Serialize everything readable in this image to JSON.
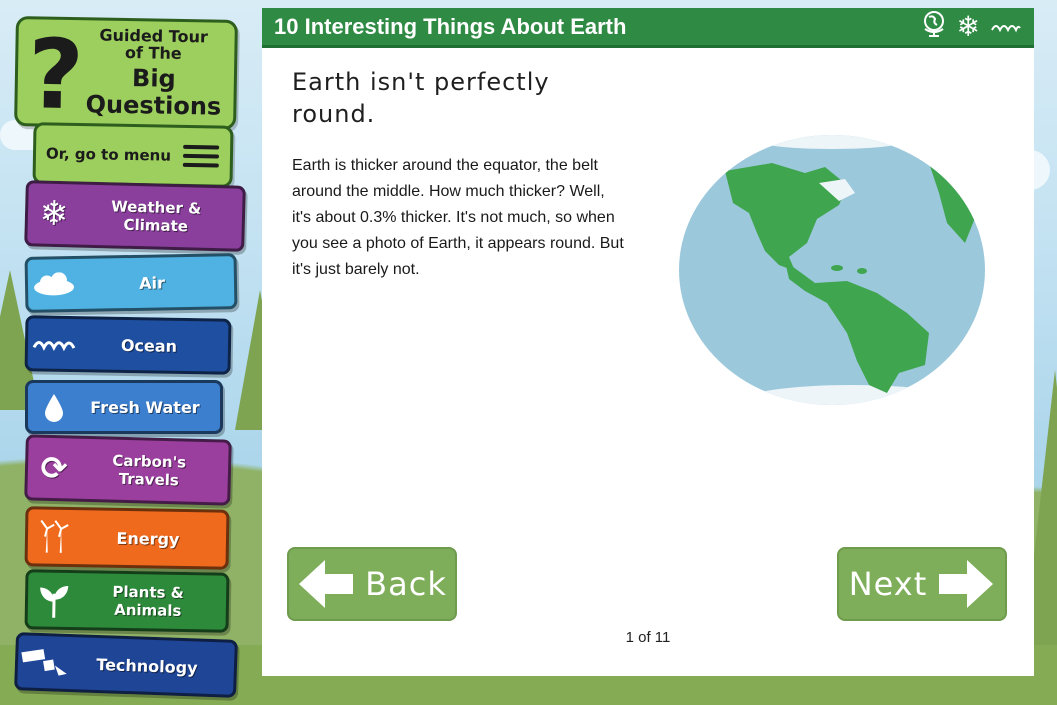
{
  "sidebar": {
    "guided_tour": {
      "line1": "Guided Tour",
      "line2": "of The",
      "line3": "Big",
      "line4": "Questions"
    },
    "menu_label": "Or, go to menu",
    "items": [
      {
        "label": "Weather & Climate",
        "color": "#8a3f9c",
        "icon": "snowflake-icon"
      },
      {
        "label": "Air",
        "color": "#4fb2e3",
        "icon": "cloud-icon"
      },
      {
        "label": "Ocean",
        "color": "#1f4fa0",
        "icon": "waves-icon"
      },
      {
        "label": "Fresh Water",
        "color": "#3d7fcf",
        "icon": "water-drop-icon"
      },
      {
        "label": "Carbon's Travels",
        "color": "#9a3f9e",
        "icon": "recycle-icon"
      },
      {
        "label": "Energy",
        "color": "#f06a1e",
        "icon": "wind-turbine-icon"
      },
      {
        "label": "Plants & Animals",
        "color": "#2e8a3b",
        "icon": "sprout-icon"
      },
      {
        "label": "Technology",
        "color": "#1f4596",
        "icon": "satellite-icon"
      }
    ]
  },
  "panel": {
    "title": "10 Interesting Things About Earth",
    "header_icons": [
      "globe-icon",
      "snowflake-icon",
      "waves-icon"
    ],
    "headline": "Earth isn't perfectly round.",
    "body": "Earth is thicker around the equator, the belt around the middle. How much thicker? Well, it's about 0.3% thicker. It's not much, so when you see a photo of Earth, it appears round. But it's just barely not.",
    "back_label": "Back",
    "next_label": "Next",
    "pager": "1 of 11"
  },
  "colors": {
    "header_green": "#2f8a44",
    "nav_green": "#7fae5b",
    "earth_ocean": "#9cc8dc",
    "earth_land": "#3fa54f"
  }
}
